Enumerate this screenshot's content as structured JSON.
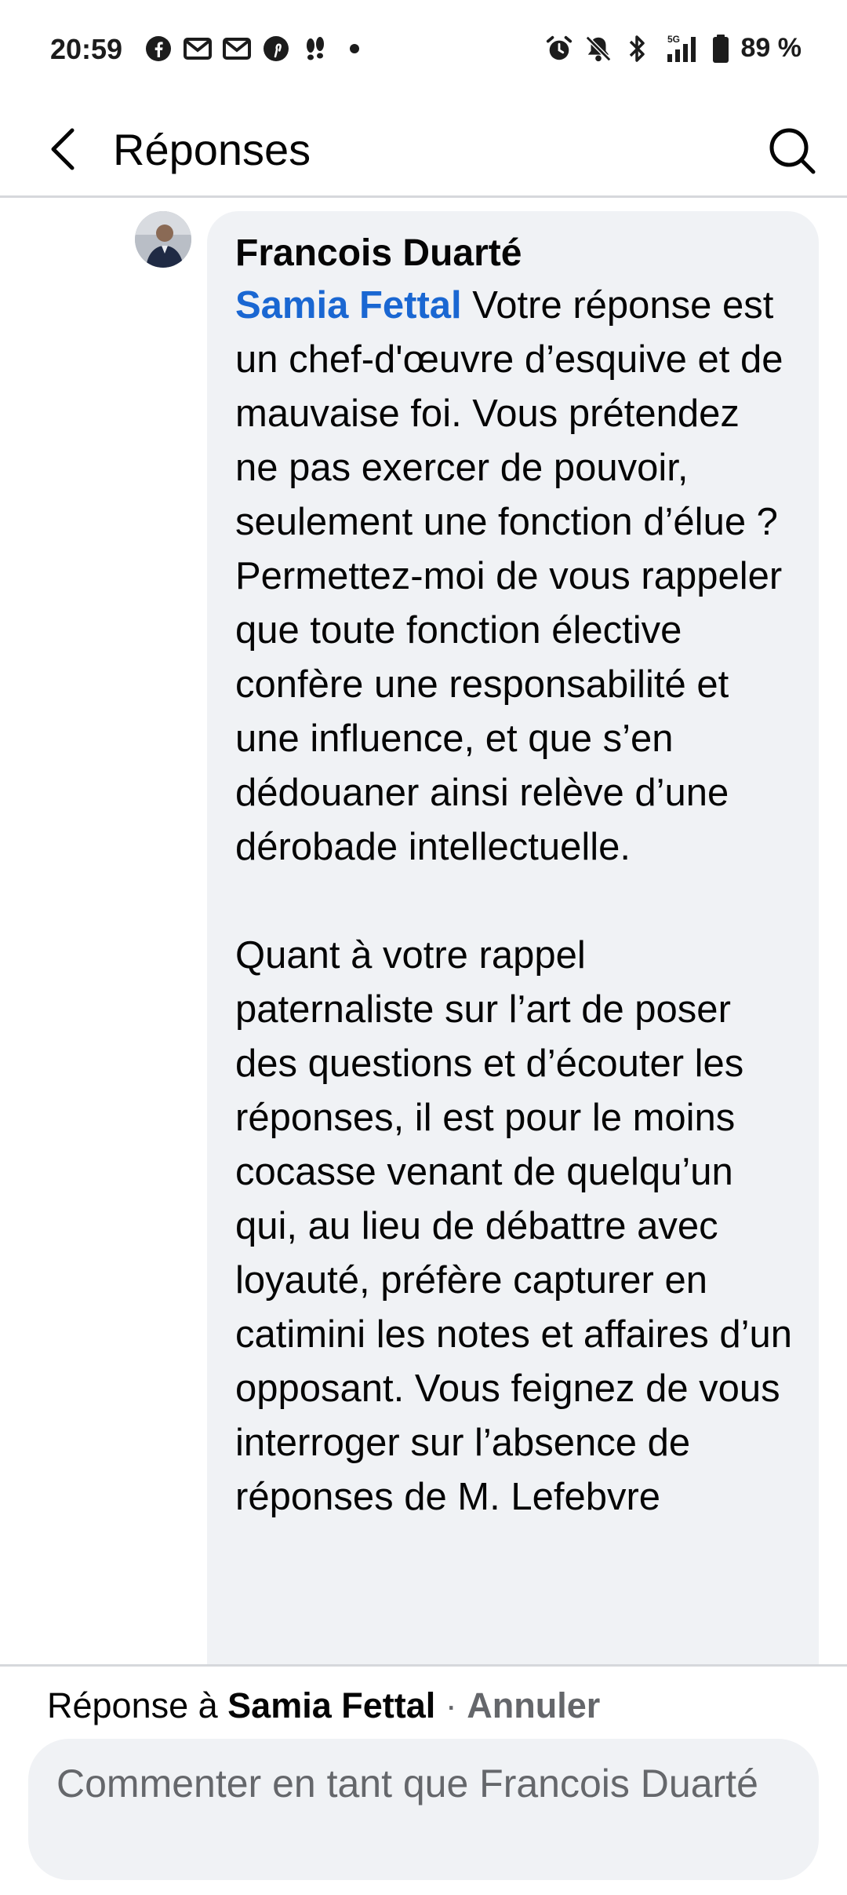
{
  "status_bar": {
    "time": "20:59",
    "battery_percent": "89 %",
    "left_icons": [
      "facebook-icon",
      "gmail-icon",
      "gmail-icon",
      "pinterest-icon",
      "footprints-icon",
      "dot-icon"
    ],
    "right_icons": [
      "alarm-icon",
      "mute-icon",
      "bluetooth-icon",
      "signal-5g-icon",
      "battery-icon"
    ]
  },
  "header": {
    "title": "Réponses"
  },
  "comment": {
    "author": "Francois Duarté",
    "mention": "Samia Fettal",
    "paragraph1": " Votre réponse est un chef-d'œuvre d’esquive et de mauvaise foi. Vous prétendez ne pas exercer de pouvoir, seulement une fonction d’élue ? Permettez-moi de vous rappeler que toute fonction élective confère une responsabilité et une influence, et que s’en dédouaner ainsi relève d’une dérobade intellectuelle.",
    "paragraph2": "Quant à votre rappel paternaliste sur l’art de poser des questions et d’écouter les réponses, il est pour le moins cocasse venant de quelqu’un qui, au lieu de débattre avec loyauté, préfère capturer en catimini les notes et affaires d’un opposant. Vous feignez de vous interroger sur l’absence de réponses de M. Lefebvre"
  },
  "reply_bar": {
    "prefix": "Réponse à ",
    "reply_to": "Samia Fettal",
    "separator": " · ",
    "cancel_label": "Annuler",
    "input_placeholder": "Commenter en tant que Francois Duarté",
    "input_value": ""
  },
  "colors": {
    "mention": "#1a67d2",
    "bubble_bg": "#f0f2f5",
    "secondary_text": "#65676b"
  }
}
